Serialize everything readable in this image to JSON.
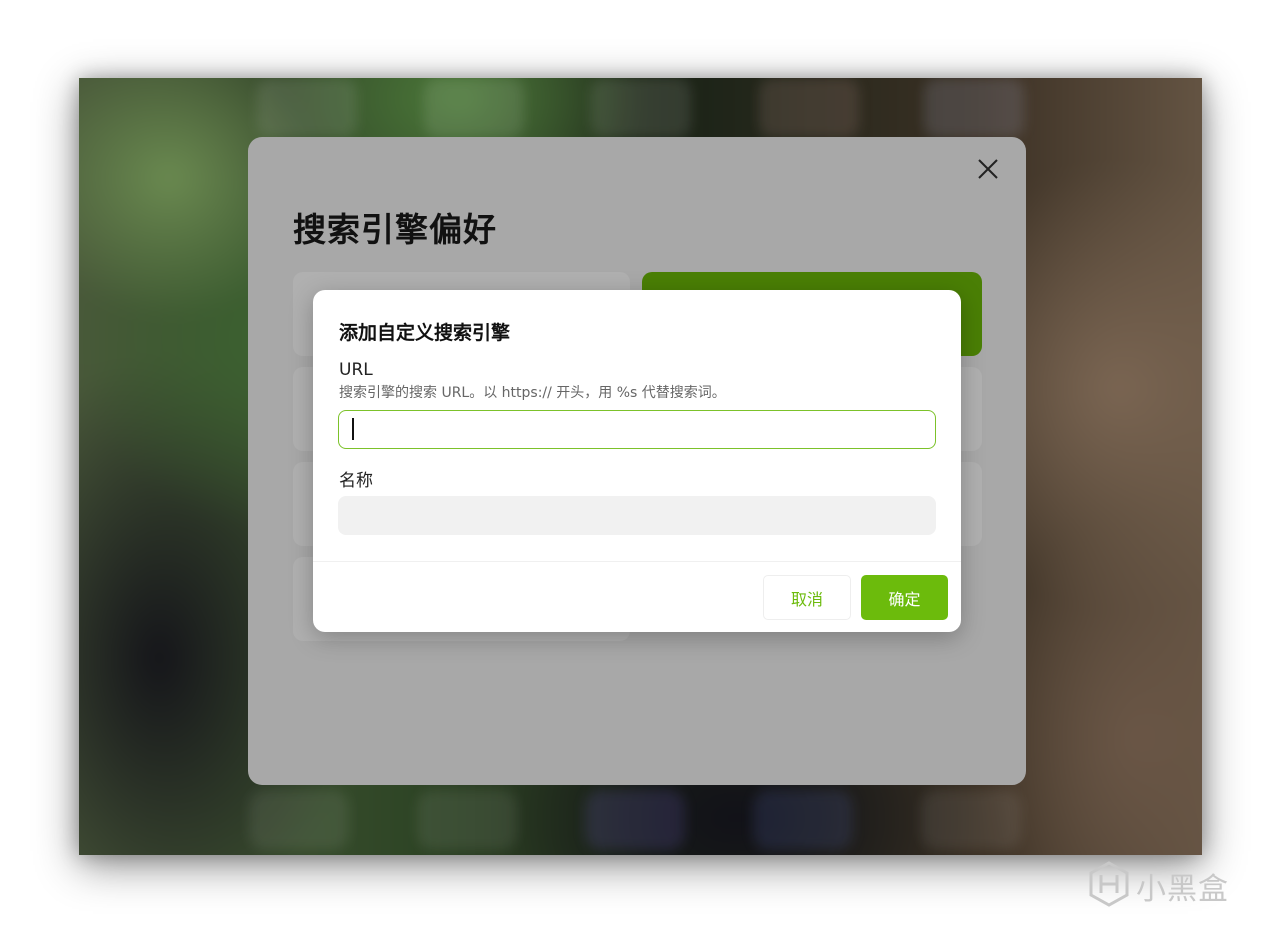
{
  "panel": {
    "title": "搜索引擎偏好"
  },
  "dialog": {
    "title": "添加自定义搜索引擎",
    "url_label": "URL",
    "url_help": "搜索引擎的搜索 URL。以 https:// 开头，用 %s 代替搜索词。",
    "url_value": "",
    "name_label": "名称",
    "name_value": "",
    "cancel_label": "取消",
    "ok_label": "确定"
  },
  "colors": {
    "accent": "#6cbb0c",
    "selected_card": "#4a7f05",
    "focus_border": "#7cc22a"
  },
  "watermark": {
    "text": "小黑盒",
    "icon": "heybox-logo-icon"
  }
}
